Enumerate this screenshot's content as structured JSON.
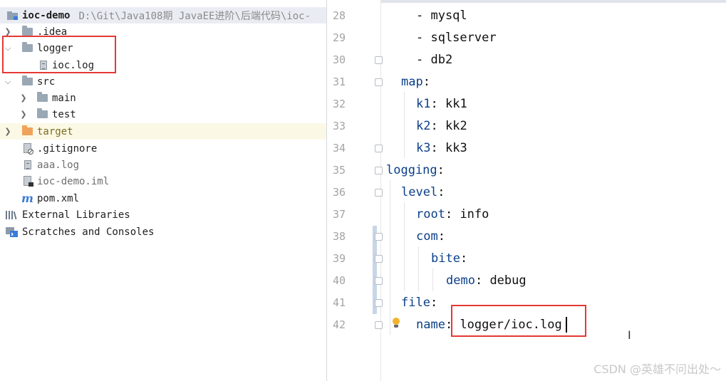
{
  "project_tree": {
    "root": {
      "name": "ioc-demo",
      "path": "D:\\Git\\Java108期 JavaEE进阶\\后端代码\\ioc-"
    },
    "items": [
      {
        "label": ".idea"
      },
      {
        "label": "logger"
      },
      {
        "label": "ioc.log"
      },
      {
        "label": "src"
      },
      {
        "label": "main"
      },
      {
        "label": "test"
      },
      {
        "label": "target"
      },
      {
        "label": ".gitignore"
      },
      {
        "label": "aaa.log"
      },
      {
        "label": "ioc-demo.iml"
      },
      {
        "label": "pom.xml"
      },
      {
        "label": "External Libraries"
      },
      {
        "label": "Scratches and Consoles"
      }
    ],
    "colors": {
      "highlight_row": "#fbf9e6",
      "annotation_box": "#e53935"
    }
  },
  "editor": {
    "lines": [
      {
        "num": "28",
        "text": "- mysql"
      },
      {
        "num": "29",
        "text": "- sqlserver"
      },
      {
        "num": "30",
        "text": "- db2"
      },
      {
        "num": "31",
        "key": "map",
        "value": ""
      },
      {
        "num": "32",
        "key": "k1",
        "value": " kk1"
      },
      {
        "num": "33",
        "key": "k2",
        "value": " kk2"
      },
      {
        "num": "34",
        "key": "k3",
        "value": " kk3"
      },
      {
        "num": "35",
        "key": "logging",
        "value": ""
      },
      {
        "num": "36",
        "key": "level",
        "value": ""
      },
      {
        "num": "37",
        "key": "root",
        "value": " info"
      },
      {
        "num": "38",
        "key": "com",
        "value": ""
      },
      {
        "num": "39",
        "key": "bite",
        "value": ""
      },
      {
        "num": "40",
        "key": "demo",
        "value": " debug"
      },
      {
        "num": "41",
        "key": "file",
        "value": ""
      },
      {
        "num": "42",
        "key": "name",
        "value": " logger/ioc.log"
      }
    ],
    "colors": {
      "yaml_key": "#0b3f8a",
      "line_number": "#a4a4a4"
    },
    "icons": {
      "intention": "lightbulb-icon",
      "cursor": "text-cursor-icon"
    }
  },
  "watermark": "CSDN @英雄不问出处～"
}
